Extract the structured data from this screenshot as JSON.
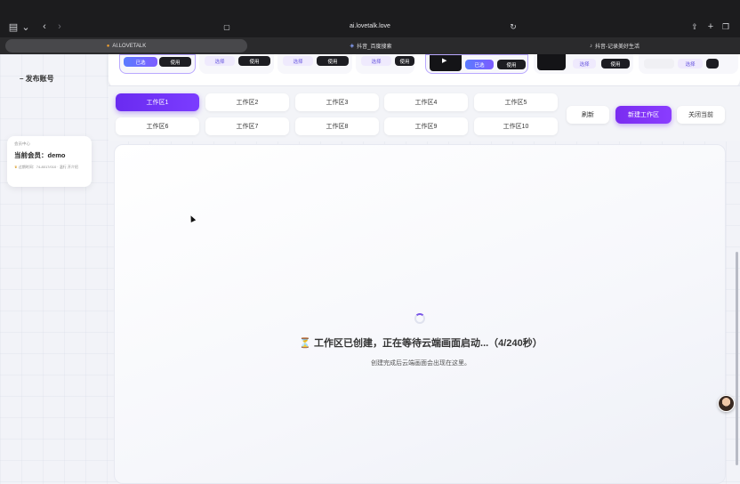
{
  "browser": {
    "url": "ai.lovetalk.love",
    "tabs": [
      {
        "label": "AI.LOVETALK",
        "active": true
      },
      {
        "label": "抖音_百度搜索",
        "active": false
      },
      {
        "label": "抖音-记录美好生活",
        "active": false
      }
    ]
  },
  "sidebar": {
    "publish_account": "发布账号",
    "member": {
      "section": "会员中心",
      "current_member": "当前会员：demo",
      "expiry": "过期时间：74-8017/010 · 温行  开介绍"
    }
  },
  "templates": {
    "selected_label": "已选",
    "select_label": "选择",
    "use_label": "使用"
  },
  "workspaces": {
    "tabs": [
      "工作区1",
      "工作区2",
      "工作区3",
      "工作区4",
      "工作区5",
      "工作区6",
      "工作区7",
      "工作区8",
      "工作区9",
      "工作区10"
    ],
    "active_index": 0,
    "refresh": "刷新",
    "new_workspace": "新建工作区",
    "close_current": "关闭当前"
  },
  "stage": {
    "status": "⏳ 工作区已创建，正在等待云端画面启动...（4/240秒）",
    "hint": "创建完成后云端画面会出现在这里。"
  },
  "colors": {
    "accent": "#7a2cf0",
    "topbar": "#1c1c1e"
  }
}
